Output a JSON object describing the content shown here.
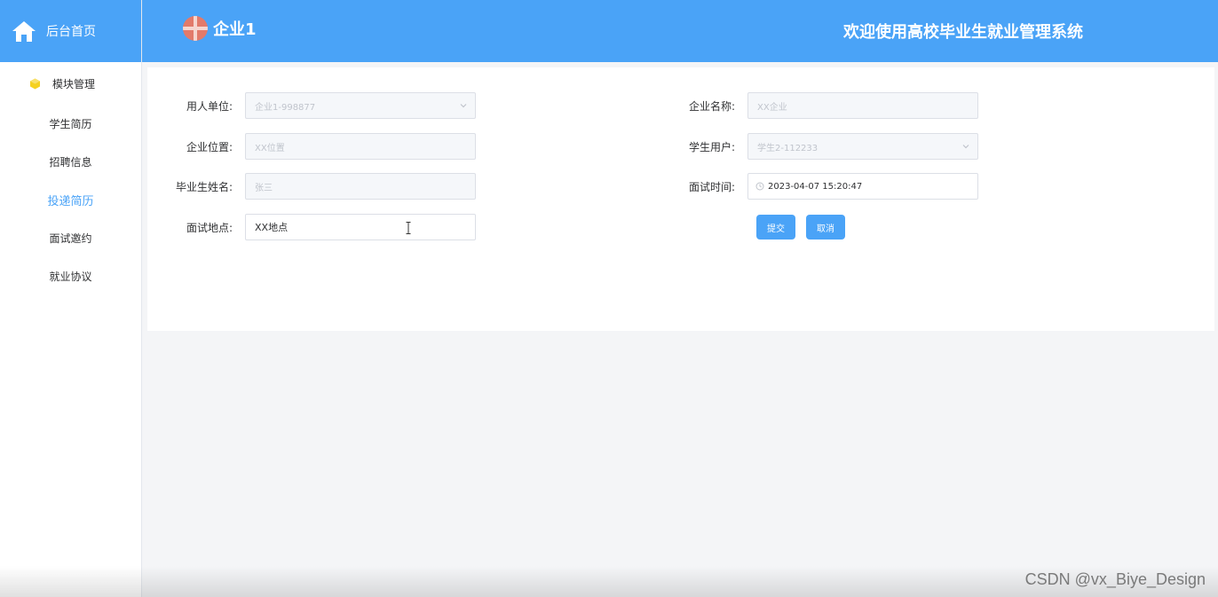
{
  "sidebar": {
    "home_label": "后台首页",
    "module_label": "模块管理",
    "items": [
      {
        "label": "学生简历",
        "active": false
      },
      {
        "label": "招聘信息",
        "active": false
      },
      {
        "label": "投递简历",
        "active": true
      },
      {
        "label": "面试邀约",
        "active": false
      },
      {
        "label": "就业协议",
        "active": false
      }
    ]
  },
  "header": {
    "brand": "企业1",
    "title": "欢迎使用高校毕业生就业管理系统"
  },
  "form": {
    "employer_label": "用人单位:",
    "employer_value": "企业1-998877",
    "company_name_label": "企业名称:",
    "company_name_value": "XX企业",
    "company_location_label": "企业位置:",
    "company_location_value": "XX位置",
    "student_user_label": "学生用户:",
    "student_user_value": "学生2-112233",
    "graduate_name_label": "毕业生姓名:",
    "graduate_name_value": "张三",
    "interview_time_label": "面试时间:",
    "interview_time_value": "2023-04-07 15:20:47",
    "interview_place_label": "面试地点:",
    "interview_place_value": "XX地点",
    "submit_label": "提交",
    "cancel_label": "取消"
  },
  "watermark": "CSDN @vx_Biye_Design",
  "colors": {
    "primary": "#4aa3f7",
    "background": "#f4f5f7"
  },
  "icons": [
    "home-icon",
    "cube-icon",
    "chevron-down-icon",
    "clock-icon",
    "text-cursor-icon"
  ]
}
